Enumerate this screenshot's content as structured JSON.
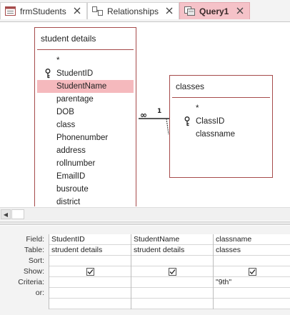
{
  "tabs": [
    {
      "label": "frmStudents",
      "icon": "form-icon",
      "active": false
    },
    {
      "label": "Relationships",
      "icon": "relationships-icon",
      "active": false
    },
    {
      "label": "Query1",
      "icon": "query-icon",
      "active": true
    }
  ],
  "tables": {
    "student_details": {
      "title": "student details",
      "fields": [
        "*",
        "StudentID",
        "StudentName",
        "parentage",
        "DOB",
        "class",
        "Phonenumber",
        "address",
        "rollnumber",
        "EmailID",
        "busroute",
        "district"
      ],
      "key_field": "StudentID",
      "selected_field": "StudentName"
    },
    "classes": {
      "title": "classes",
      "fields": [
        "*",
        "ClassID",
        "classname"
      ],
      "key_field": "ClassID"
    }
  },
  "relationship": {
    "one_label": "1",
    "many_label": "∞"
  },
  "colors": {
    "accent": "#a64b4b",
    "selected": "#f5b9bd",
    "active_tab": "#f5c2c8"
  },
  "grid": {
    "row_labels": [
      "Field:",
      "Table:",
      "Sort:",
      "Show:",
      "Criteria:",
      "or:"
    ],
    "columns": [
      {
        "field": "StudentID",
        "table": "strudent details",
        "sort": "",
        "show": true,
        "criteria": "",
        "or": ""
      },
      {
        "field": "StudentName",
        "table": "strudent details",
        "sort": "",
        "show": true,
        "criteria": "",
        "or": ""
      },
      {
        "field": "classname",
        "table": "classes",
        "sort": "",
        "show": true,
        "criteria": "\"9th\"",
        "or": ""
      }
    ]
  }
}
